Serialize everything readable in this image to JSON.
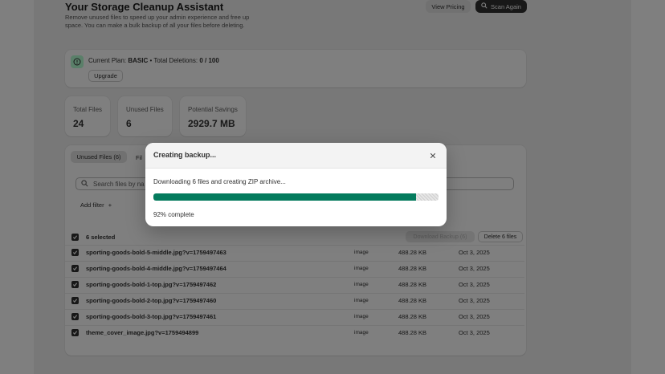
{
  "header": {
    "title": "Your Storage Cleanup Assistant",
    "description": "Remove unused files to speed up your admin experience and free up space. You can make a bulk backup of all your files before deleting.",
    "view_pricing_label": "View Pricing",
    "scan_again_label": "Scan Again"
  },
  "plan": {
    "prefix": "Current Plan:",
    "name": "BASIC",
    "separator": "•",
    "deletions_label": "Total Deletions:",
    "deletions_value": "0 / 100",
    "upgrade_label": "Upgrade"
  },
  "stats": [
    {
      "label": "Total Files",
      "value": "24"
    },
    {
      "label": "Unused Files",
      "value": "6"
    },
    {
      "label": "Potential Savings",
      "value": "2929.7 MB"
    }
  ],
  "files_panel": {
    "tabs": [
      {
        "label": "Unused Files (6)"
      },
      {
        "label": "Fil"
      }
    ],
    "search_placeholder": "Search files by na",
    "add_filter_label": "Add filter",
    "add_filter_icon": "plus",
    "selected_label": "6 selected",
    "download_backup_label": "Download Backup (6)",
    "delete_label": "Delete 6 files",
    "rows": [
      {
        "name": "sporting-goods-bold-5-middle.jpg?v=1759497463",
        "type": "image",
        "size": "488.28 KB",
        "date": "Oct 3, 2025"
      },
      {
        "name": "sporting-goods-bold-4-middle.jpg?v=1759497464",
        "type": "image",
        "size": "488.28 KB",
        "date": "Oct 3, 2025"
      },
      {
        "name": "sporting-goods-bold-1-top.jpg?v=1759497462",
        "type": "image",
        "size": "488.28 KB",
        "date": "Oct 3, 2025"
      },
      {
        "name": "sporting-goods-bold-2-top.jpg?v=1759497460",
        "type": "image",
        "size": "488.28 KB",
        "date": "Oct 3, 2025"
      },
      {
        "name": "sporting-goods-bold-3-top.jpg?v=1759497461",
        "type": "image",
        "size": "488.28 KB",
        "date": "Oct 3, 2025"
      },
      {
        "name": "theme_cover_image.jpg?v=1759494899",
        "type": "image",
        "size": "488.28 KB",
        "date": "Oct 3, 2025"
      }
    ]
  },
  "modal": {
    "title": "Creating backup...",
    "message": "Downloading 6 files and creating ZIP archive...",
    "progress_percent": 92,
    "progress_label": "92% complete",
    "progress_color": "#047b5d"
  },
  "icons": {
    "plan": "info-circle-icon",
    "scan": "search-icon",
    "search": "search-icon",
    "close": "close-icon",
    "checkbox": "checkmark-icon"
  }
}
